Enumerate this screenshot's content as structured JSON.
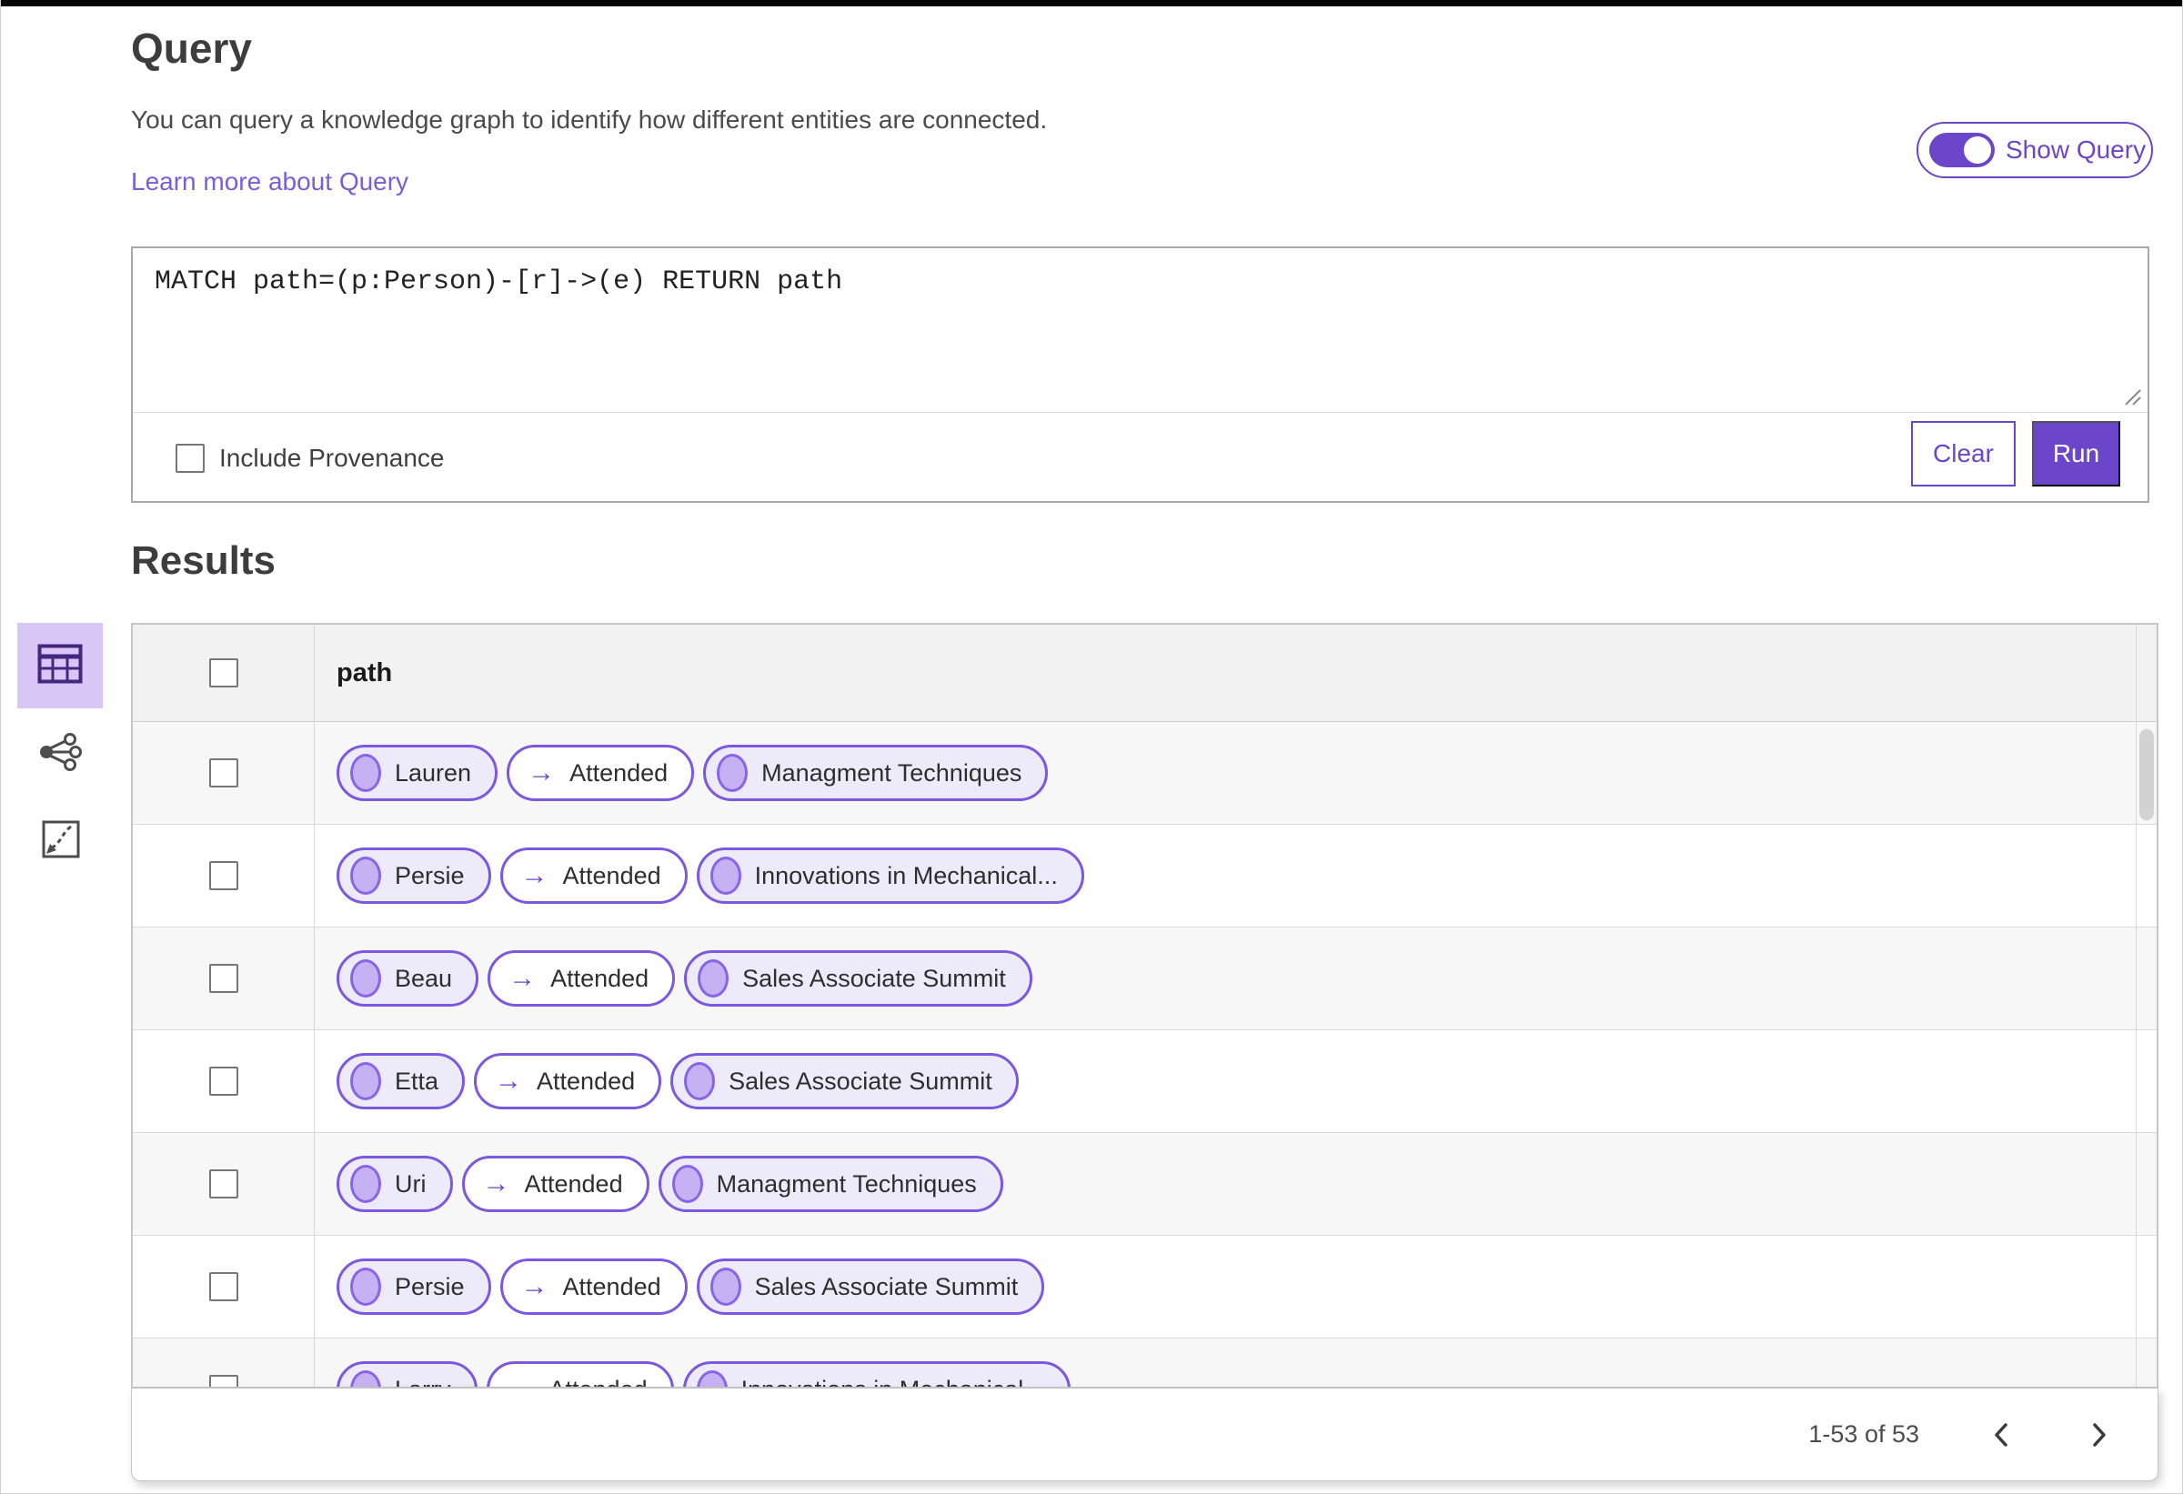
{
  "header": {
    "title": "Query",
    "description": "You can query a knowledge graph to identify how different entities are connected.",
    "learn_more_link": "Learn more about Query",
    "show_query_label": "Show Query",
    "show_query_on": true
  },
  "query_editor": {
    "query_text": "MATCH path=(p:Person)-[r]->(e) RETURN path",
    "include_provenance_label": "Include Provenance",
    "include_provenance_checked": false,
    "clear_button": "Clear",
    "run_button": "Run"
  },
  "sidebar": {
    "views": [
      {
        "id": "table-view",
        "icon": "table-icon",
        "selected": true
      },
      {
        "id": "network-view",
        "icon": "network-graph-icon",
        "selected": false
      },
      {
        "id": "chart-view",
        "icon": "path-chart-icon",
        "selected": false
      }
    ]
  },
  "results": {
    "title": "Results",
    "column_header": "path",
    "edge_arrow": "→",
    "rows": [
      {
        "source": "Lauren",
        "edge": "Attended",
        "target": "Managment Techniques"
      },
      {
        "source": "Persie",
        "edge": "Attended",
        "target": "Innovations in Mechanical..."
      },
      {
        "source": "Beau",
        "edge": "Attended",
        "target": "Sales Associate Summit"
      },
      {
        "source": "Etta",
        "edge": "Attended",
        "target": "Sales Associate Summit"
      },
      {
        "source": "Uri",
        "edge": "Attended",
        "target": "Managment Techniques"
      },
      {
        "source": "Persie",
        "edge": "Attended",
        "target": "Sales Associate Summit"
      },
      {
        "source": "Larry",
        "edge": "Attended",
        "target": "Innovations in Mechanical..."
      }
    ],
    "pagination": {
      "range_label": "1-53 of 53"
    }
  },
  "colors": {
    "accent": "#6b46c8",
    "pill_border": "#7c57e0",
    "node_pill_bg": "#edebfa",
    "node_dot_fill": "#c6b2f2",
    "selected_view_bg": "#d9c6f6",
    "link": "#7560d4"
  }
}
